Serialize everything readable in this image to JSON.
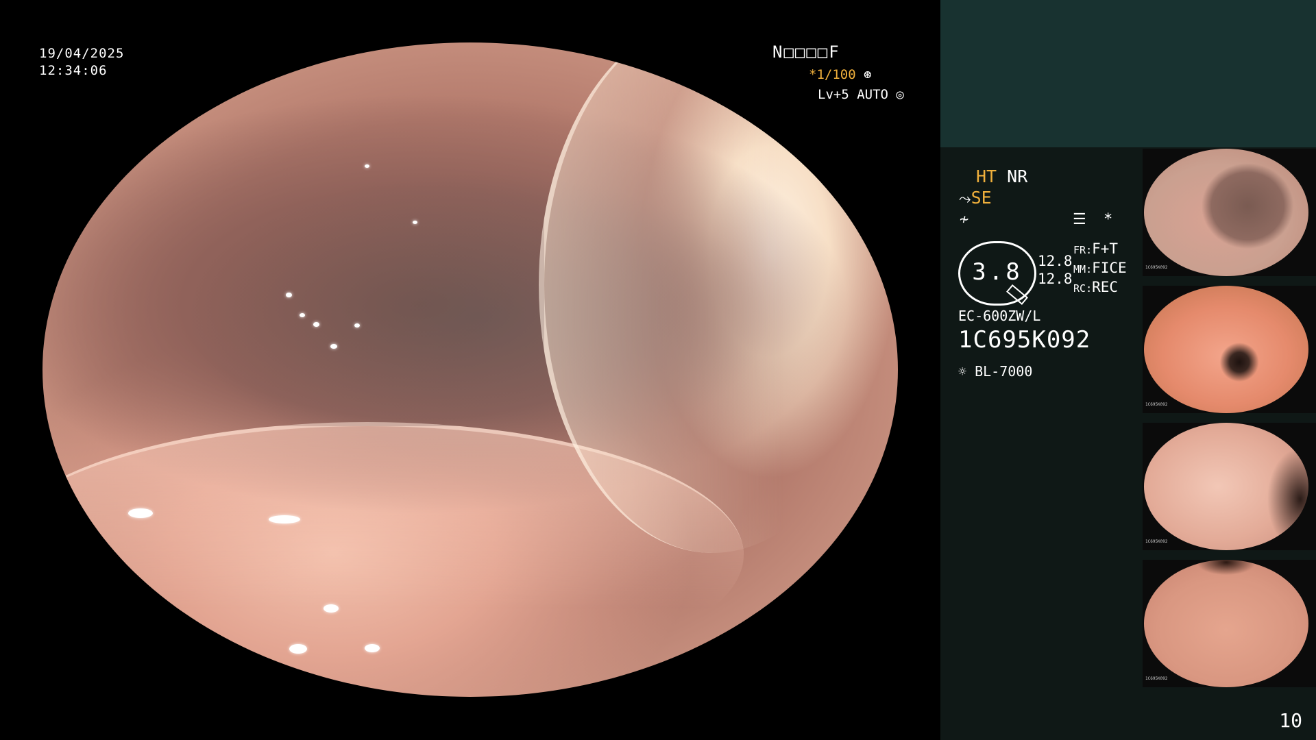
{
  "osd": {
    "date": "19/04/2025",
    "time": "12:34:06",
    "patient_code": "N□□□□F",
    "shutter": "*1/100",
    "shutter_icon": "shutter-icon",
    "iris": "Lv+5 AUTO",
    "iris_icon": "iris-icon"
  },
  "panel": {
    "ht_label": "HT",
    "nr_label": "NR",
    "se_label": "SE",
    "zoom_value": "3.8",
    "values": [
      "12.8",
      "12.8"
    ],
    "keys": [
      {
        "key": "FR",
        "value": "F+T"
      },
      {
        "key": "MM",
        "value": "FICE"
      },
      {
        "key": "RC",
        "value": "REC"
      }
    ],
    "model": "EC-600ZW/L",
    "serial": "1C695K092",
    "light_source": "BL-7000",
    "frame_count": "10"
  },
  "thumbnails": [
    {
      "serial": "1C695K092"
    },
    {
      "serial": "1C695K092"
    },
    {
      "serial": "1C695K092"
    },
    {
      "serial": "1C695K092"
    }
  ],
  "colors": {
    "accent": "#f0b03c",
    "panel_bg": "#0f1816",
    "panel_top": "#183230"
  }
}
